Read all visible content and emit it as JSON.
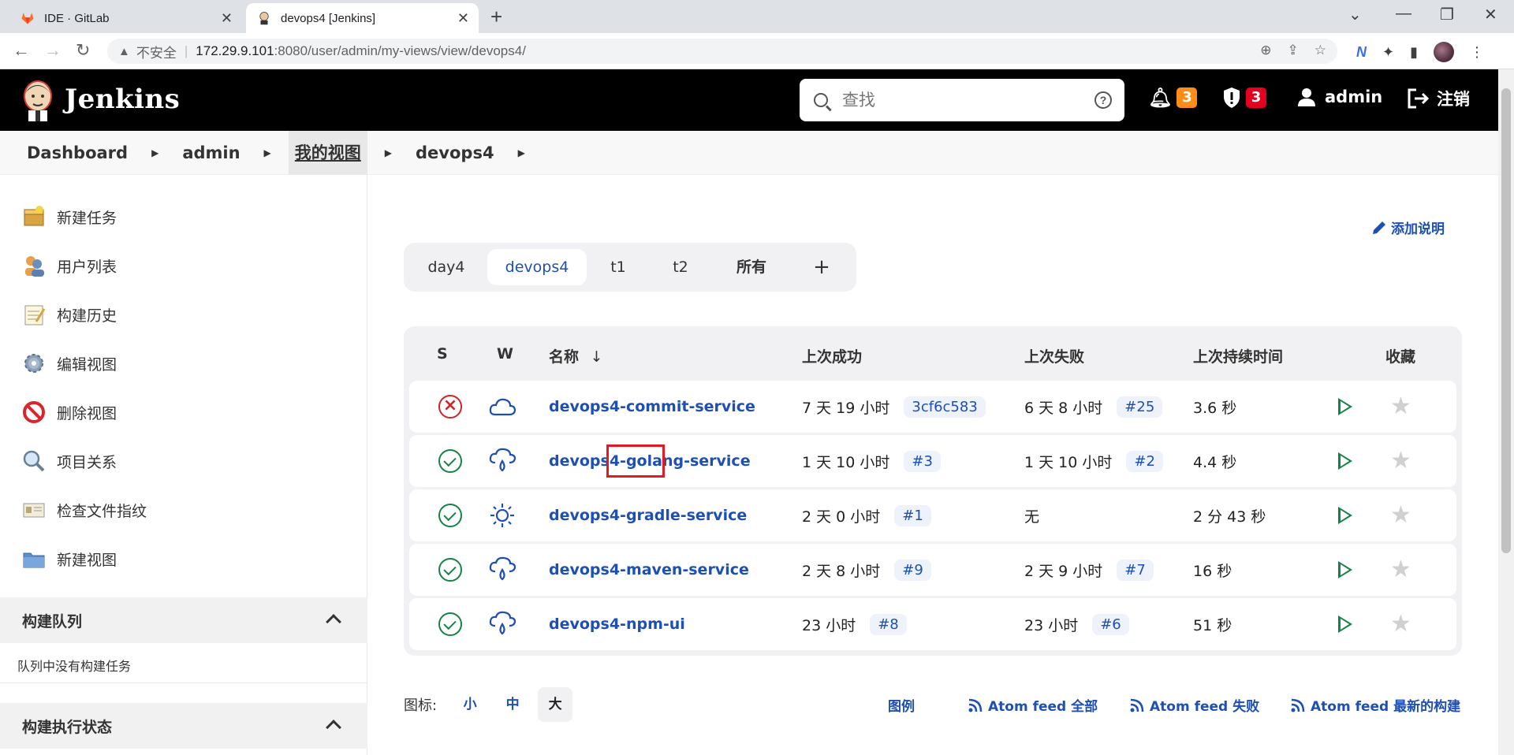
{
  "browser": {
    "tabs": [
      {
        "title": "IDE · GitLab",
        "active": false
      },
      {
        "title": "devops4 [Jenkins]",
        "active": true
      }
    ],
    "address": {
      "security_label": "不安全",
      "url_host": "172.29.9.101",
      "url_rest": ":8080/user/admin/my-views/view/devops4/"
    }
  },
  "header": {
    "app_title": "Jenkins",
    "search_placeholder": "查找",
    "notifications_count": "3",
    "security_count": "3",
    "user": "admin",
    "logout": "注销"
  },
  "breadcrumb": [
    "Dashboard",
    "admin",
    "我的视图",
    "devops4"
  ],
  "sidebar": {
    "items": [
      {
        "label": "新建任务",
        "icon": "new-package-icon"
      },
      {
        "label": "用户列表",
        "icon": "users-icon"
      },
      {
        "label": "构建历史",
        "icon": "notepad-icon"
      },
      {
        "label": "编辑视图",
        "icon": "gear-icon"
      },
      {
        "label": "删除视图",
        "icon": "no-entry-icon"
      },
      {
        "label": "项目关系",
        "icon": "magnifier-icon"
      },
      {
        "label": "检查文件指纹",
        "icon": "fingerprint-card-icon"
      },
      {
        "label": "新建视图",
        "icon": "folder-icon"
      }
    ],
    "build_queue": {
      "title": "构建队列",
      "empty_text": "队列中没有构建任务"
    },
    "executors": {
      "title": "构建执行状态"
    }
  },
  "main": {
    "add_description": "添加说明",
    "view_tabs": [
      "day4",
      "devops4",
      "t1",
      "t2",
      "所有",
      "+"
    ],
    "active_view": "devops4",
    "columns": {
      "s": "S",
      "w": "W",
      "name": "名称",
      "sort_arrow": "↓",
      "last_success": "上次成功",
      "last_failure": "上次失败",
      "last_duration": "上次持续时间",
      "favorite": "收藏"
    },
    "jobs": [
      {
        "status": "failed",
        "weather": "cloud-icon",
        "name": "devops4-commit-service",
        "last_success": "7 天 19 小时",
        "success_build": "3cf6c583",
        "last_failure": "6 天 8 小时",
        "failure_build": "#25",
        "duration": "3.6 秒"
      },
      {
        "status": "success",
        "weather": "rain-icon",
        "name_prefix": "devops4-",
        "name_highlight": "golang",
        "name_suffix": "-service",
        "last_success": "1 天 10 小时",
        "success_build": "#3",
        "last_failure": "1 天 10 小时",
        "failure_build": "#2",
        "duration": "4.4 秒"
      },
      {
        "status": "success",
        "weather": "sun-icon",
        "name": "devops4-gradle-service",
        "last_success": "2 天 0 小时",
        "success_build": "#1",
        "last_failure": "无",
        "failure_build": "",
        "duration": "2 分 43 秒"
      },
      {
        "status": "success",
        "weather": "rain-icon",
        "name": "devops4-maven-service",
        "last_success": "2 天 8 小时",
        "success_build": "#9",
        "last_failure": "2 天 9 小时",
        "failure_build": "#7",
        "duration": "16 秒"
      },
      {
        "status": "success",
        "weather": "rain-icon",
        "name": "devops4-npm-ui",
        "last_success": "23 小时",
        "success_build": "#8",
        "last_failure": "23 小时",
        "failure_build": "#6",
        "duration": "51 秒"
      }
    ],
    "footer": {
      "icon_label": "图标:",
      "sizes": [
        "小",
        "中",
        "大"
      ],
      "active_size": "大",
      "legend": "图例",
      "feed_all": "Atom feed 全部",
      "feed_failed": "Atom feed 失败",
      "feed_latest": "Atom feed 最新的构建"
    }
  },
  "colors": {
    "link": "#1d4fb5",
    "success": "#138347",
    "failure": "#d1232a",
    "highlight_box": "#e01b24",
    "badge_orange": "#fe8c19",
    "badge_red": "#e6001f"
  }
}
